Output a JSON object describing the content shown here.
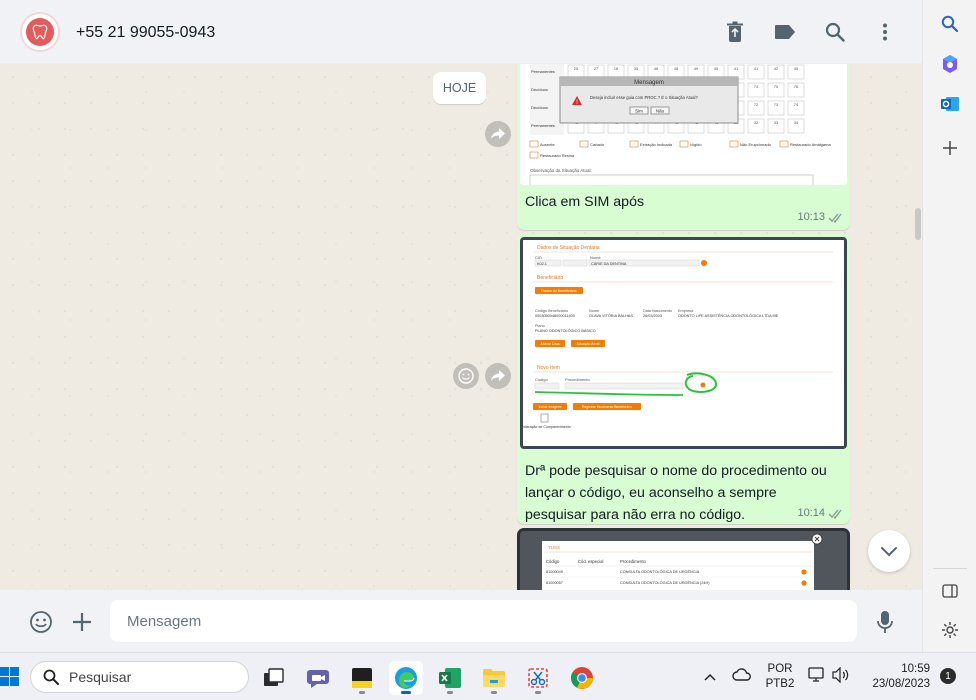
{
  "header": {
    "contact_name": "+55 21 99055-0943",
    "icons": [
      "delete-icon",
      "label-icon",
      "search-icon",
      "menu-icon"
    ]
  },
  "chat": {
    "date_chip": "HOJE",
    "messages": [
      {
        "caption": "Clica em SIM após",
        "time": "10:13",
        "status": "read",
        "screenshot": {
          "grid_header": [
            "25",
            "27",
            "18",
            "35",
            "46",
            "48",
            "49",
            "45",
            "41",
            "41",
            "42",
            "45"
          ],
          "rows": [
            {
              "label": "Permanentes",
              "cells": [
                "25",
                "27",
                "18",
                "35",
                "46",
                "48",
                "49",
                "45",
                "41",
                "41",
                "42",
                "45"
              ]
            },
            {
              "label": "Decíduos",
              "cells": [
                "85",
                "64",
                "63",
                "62",
                "65",
                "66",
                "67",
                "68",
                "69",
                "74",
                "75",
                "76"
              ]
            },
            {
              "label": "Decíduos",
              "cells": [
                "85",
                "64",
                "63",
                "62",
                "65",
                "66",
                "67",
                "68",
                "71",
                "72",
                "73",
                "74"
              ]
            },
            {
              "label": "Permanentes",
              "cells": [
                "48",
                "47",
                "46",
                "45",
                "44",
                "43",
                "42",
                "41",
                "31",
                "32",
                "33",
                "34"
              ]
            }
          ],
          "dialog_title": "Mensagem",
          "dialog_text": "Deseja incluir esse guia com PROC.? É o Situação Atual?",
          "dialog_buttons": [
            "Sim",
            "Não"
          ],
          "legend": [
            "Ausente",
            "Cariado",
            "Extração Indicada",
            "Hígido",
            "Não Erupcionado",
            "Restaurado Amálgama",
            "Restaurado Resina"
          ],
          "observation_label": "Observação da Situação Atual:"
        }
      },
      {
        "caption": "Drª pode pesquisar o nome do procedimento ou lançar o código, eu aconselho a sempre pesquisar para não erra no código.",
        "time": "10:14",
        "status": "read",
        "screenshot": {
          "section_title": "Dados de Situação Dentária",
          "cid_label": "CID",
          "cid_value": "K02.1",
          "name_label": "Nome",
          "name_value": "CÁRIE DA DENTINA",
          "beneficiary_section": "Beneficiário",
          "beneficiary_button": "Dados do Beneficiário",
          "fields": {
            "code_label": "Código Beneficiário",
            "code_value": "0003050048000011400",
            "name_label": "Nome",
            "name_value": "OLAVA VITÓRIA BALHAS",
            "birth_label": "Data Nascimento",
            "birth_value": "26/03/2003",
            "company_label": "Empresa",
            "company_value": "ODONTO LIFE ASSISTÊNCIA ODONTOLÓGICA LTDA ME",
            "plan_label": "Plano",
            "plan_value": "PLANO ODONTOLÓGICO BÁSICO"
          },
          "buttons": [
            "Alterar Data",
            "Situação Atual"
          ],
          "new_item_section": "Novo Item",
          "code_col": "Código",
          "procedure_col": "Procedimento",
          "bottom_buttons": [
            "Incluir Imagens",
            "Registrar Movimento Beneficiário"
          ],
          "declaration_label": "Declaração de Comparecimento"
        }
      },
      {
        "screenshot": {
          "panel_title": "TUSS",
          "columns": [
            "Código",
            "Cód. especial",
            "Procedimento"
          ],
          "rows": [
            {
              "code": "81000049",
              "special": "",
              "procedure": "CONSULTA ODONTOLÓGICA DE URGÊNCIA"
            },
            {
              "code": "81000057",
              "special": "",
              "procedure": "CONSULTA ODONTOLÓGICA DE URGÊNCIA (24H)"
            }
          ]
        }
      }
    ]
  },
  "composer": {
    "placeholder": "Mensagem"
  },
  "taskbar": {
    "search_placeholder": "Pesquisar",
    "language": "POR",
    "keyboard": "PTB2",
    "time": "10:59",
    "date": "23/08/2023",
    "notification_count": "1"
  },
  "colors": {
    "bubble_outgoing": "#d9fdd3",
    "chat_background": "#efeae2",
    "read_check": "#53bdeb",
    "highlight_orange": "#f57c00",
    "annotation_green": "#28c43a"
  }
}
